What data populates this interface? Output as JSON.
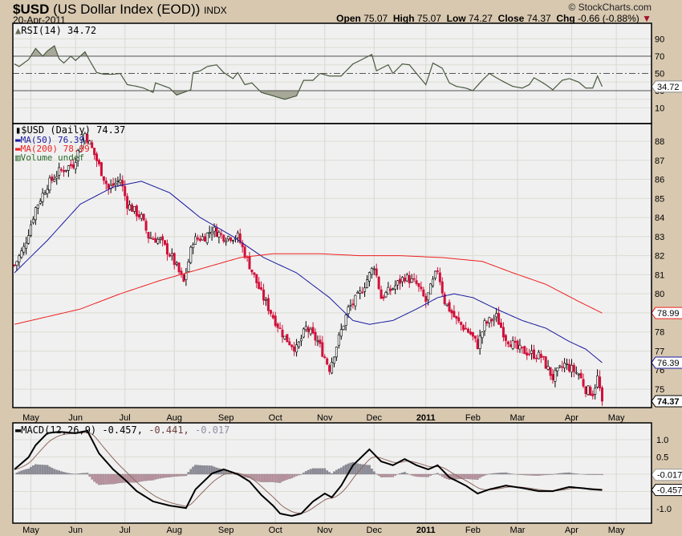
{
  "header": {
    "symbol": "$USD",
    "name": "(US Dollar Index (EOD))",
    "exchange": "INDX",
    "date": "20-Apr-2011",
    "brand": "© StockCharts.com",
    "open_label": "Open",
    "open": "75.07",
    "high_label": "High",
    "high": "75.07",
    "low_label": "Low",
    "low": "74.27",
    "close_label": "Close",
    "close": "74.37",
    "chg_label": "Chg",
    "chg": "-0.66 (-0.88%)"
  },
  "colors": {
    "background": "#d8c8b0",
    "plot": "#f0f0f0",
    "up": "#000000",
    "down": "#d0103a",
    "ma50": "#1a1aa0",
    "ma200": "#ee2020",
    "rsi": "#4a5a40",
    "rsi_fill": "#a8a898",
    "hist_pos": "#8a8a9a",
    "hist_neg": "#c090a0",
    "signal": "#906860"
  },
  "chart_data": [
    {
      "type": "line",
      "title": "RSI(14) 34.72",
      "legend": "RSI(14) 34.72",
      "last": "34.72",
      "ylim": [
        0,
        100
      ],
      "yticks": [
        "90",
        "70",
        "50",
        "30",
        "10"
      ],
      "overbought": 70,
      "oversold": 30,
      "x_units": "trading day index",
      "points": [
        [
          0,
          61
        ],
        [
          2,
          58
        ],
        [
          6,
          66
        ],
        [
          9,
          79
        ],
        [
          12,
          70
        ],
        [
          14,
          76
        ],
        [
          17,
          82
        ],
        [
          19,
          67
        ],
        [
          21,
          62
        ],
        [
          24,
          70
        ],
        [
          26,
          65
        ],
        [
          30,
          75
        ],
        [
          32,
          65
        ],
        [
          35,
          51
        ],
        [
          38,
          49
        ],
        [
          42,
          49
        ],
        [
          45,
          50
        ],
        [
          48,
          37
        ],
        [
          52,
          35
        ],
        [
          55,
          33
        ],
        [
          59,
          28
        ],
        [
          60,
          39
        ],
        [
          66,
          33
        ],
        [
          69,
          25
        ],
        [
          72,
          28
        ],
        [
          75,
          31
        ],
        [
          76,
          51
        ],
        [
          79,
          53
        ],
        [
          82,
          58
        ],
        [
          86,
          60
        ],
        [
          89,
          51
        ],
        [
          93,
          44
        ],
        [
          95,
          51
        ],
        [
          98,
          37
        ],
        [
          101,
          39
        ],
        [
          105,
          28
        ],
        [
          110,
          24
        ],
        [
          115,
          20
        ],
        [
          120,
          24
        ],
        [
          123,
          42
        ],
        [
          127,
          42
        ],
        [
          130,
          50
        ],
        [
          134,
          47
        ],
        [
          139,
          47
        ],
        [
          144,
          61
        ],
        [
          147,
          65
        ],
        [
          152,
          72
        ],
        [
          154,
          53
        ],
        [
          159,
          60
        ],
        [
          161,
          50
        ],
        [
          165,
          61
        ],
        [
          168,
          60
        ],
        [
          171,
          50
        ],
        [
          175,
          37
        ],
        [
          178,
          62
        ],
        [
          182,
          56
        ],
        [
          185,
          39
        ],
        [
          188,
          35
        ],
        [
          192,
          33
        ],
        [
          195,
          30
        ],
        [
          199,
          42
        ],
        [
          202,
          50
        ],
        [
          205,
          45
        ],
        [
          209,
          39
        ],
        [
          212,
          35
        ],
        [
          216,
          33
        ],
        [
          219,
          37
        ],
        [
          221,
          45
        ],
        [
          223,
          42
        ],
        [
          226,
          37
        ],
        [
          229,
          31
        ],
        [
          233,
          42
        ],
        [
          236,
          44
        ],
        [
          240,
          40
        ],
        [
          243,
          33
        ],
        [
          246,
          33
        ],
        [
          248,
          47
        ],
        [
          250,
          34.72
        ]
      ]
    },
    {
      "type": "candlestick",
      "title": "$USD (Daily) 74.37",
      "legend": [
        "$USD (Daily) 74.37",
        "MA(50) 76.39",
        "MA(200) 78.99",
        "Volume undef"
      ],
      "ylim": [
        74,
        88.9
      ],
      "yticks": [
        "88",
        "87",
        "86",
        "85",
        "84",
        "83",
        "82",
        "81",
        "80",
        "79",
        "78",
        "77",
        "76",
        "75"
      ],
      "x_ticks": [
        [
          "May",
          7
        ],
        [
          "Jun",
          26
        ],
        [
          "Jul",
          47
        ],
        [
          "Aug",
          68
        ],
        [
          "Sep",
          90
        ],
        [
          "Oct",
          111
        ],
        [
          "Nov",
          132
        ],
        [
          "Dec",
          153
        ],
        [
          "2011",
          175
        ],
        [
          "Feb",
          195
        ],
        [
          "Mar",
          214
        ],
        [
          "Apr",
          237
        ],
        [
          "May",
          256
        ]
      ],
      "close": [
        [
          0,
          81.5
        ],
        [
          4,
          82.4
        ],
        [
          9,
          84.5
        ],
        [
          14,
          85.7
        ],
        [
          19,
          86.4
        ],
        [
          25,
          86.8
        ],
        [
          30,
          88.4
        ],
        [
          33,
          87.6
        ],
        [
          37,
          86.4
        ],
        [
          40,
          85.5
        ],
        [
          45,
          86.0
        ],
        [
          48,
          84.7
        ],
        [
          54,
          84.0
        ],
        [
          57,
          83.0
        ],
        [
          62,
          82.8
        ],
        [
          67,
          81.9
        ],
        [
          72,
          80.6
        ],
        [
          76,
          82.8
        ],
        [
          81,
          83.0
        ],
        [
          84,
          83.4
        ],
        [
          89,
          83.0
        ],
        [
          95,
          83.0
        ],
        [
          100,
          81.5
        ],
        [
          105,
          80.0
        ],
        [
          110,
          78.8
        ],
        [
          115,
          77.7
        ],
        [
          120,
          77.1
        ],
        [
          124,
          78.2
        ],
        [
          129,
          77.5
        ],
        [
          134,
          76.1
        ],
        [
          137,
          77.3
        ],
        [
          142,
          79.2
        ],
        [
          147,
          80.0
        ],
        [
          153,
          81.5
        ],
        [
          156,
          79.8
        ],
        [
          161,
          80.3
        ],
        [
          166,
          80.9
        ],
        [
          171,
          80.5
        ],
        [
          175,
          79.6
        ],
        [
          180,
          81.3
        ],
        [
          183,
          79.6
        ],
        [
          188,
          78.6
        ],
        [
          194,
          77.9
        ],
        [
          197,
          77.3
        ],
        [
          200,
          78.4
        ],
        [
          205,
          78.8
        ],
        [
          209,
          77.7
        ],
        [
          214,
          77.1
        ],
        [
          219,
          76.9
        ],
        [
          224,
          76.7
        ],
        [
          229,
          75.6
        ],
        [
          234,
          76.3
        ],
        [
          240,
          75.8
        ],
        [
          243,
          75.0
        ],
        [
          246,
          74.8
        ],
        [
          248,
          75.6
        ],
        [
          250,
          74.37
        ]
      ],
      "ma50": {
        "label": "MA(50) 76.39",
        "last": "76.39",
        "points": [
          [
            0,
            81.1
          ],
          [
            14,
            82.8
          ],
          [
            28,
            84.7
          ],
          [
            42,
            85.6
          ],
          [
            54,
            85.9
          ],
          [
            66,
            85.3
          ],
          [
            79,
            84.0
          ],
          [
            93,
            83.0
          ],
          [
            106,
            81.9
          ],
          [
            120,
            81.1
          ],
          [
            134,
            79.8
          ],
          [
            144,
            78.6
          ],
          [
            151,
            78.4
          ],
          [
            161,
            78.6
          ],
          [
            171,
            79.2
          ],
          [
            180,
            79.8
          ],
          [
            187,
            80.0
          ],
          [
            195,
            79.8
          ],
          [
            205,
            79.2
          ],
          [
            216,
            78.6
          ],
          [
            226,
            78.2
          ],
          [
            236,
            77.5
          ],
          [
            243,
            77.1
          ],
          [
            250,
            76.39
          ]
        ]
      },
      "ma200": {
        "label": "MA(200) 78.99",
        "last": "78.99",
        "points": [
          [
            0,
            78.4
          ],
          [
            14,
            78.8
          ],
          [
            28,
            79.2
          ],
          [
            45,
            80.0
          ],
          [
            62,
            80.7
          ],
          [
            79,
            81.3
          ],
          [
            96,
            81.9
          ],
          [
            110,
            82.1
          ],
          [
            130,
            82.1
          ],
          [
            147,
            82.0
          ],
          [
            164,
            82.0
          ],
          [
            182,
            81.9
          ],
          [
            199,
            81.7
          ],
          [
            212,
            81.1
          ],
          [
            226,
            80.5
          ],
          [
            240,
            79.6
          ],
          [
            250,
            78.99
          ]
        ]
      },
      "volume_label": "Volume undef",
      "last": "74.37"
    },
    {
      "type": "line",
      "title": "MACD(12,26,9)",
      "legend": {
        "name": "MACD(12,26,9)",
        "macd": "-0.457,",
        "signal": "-0.441,",
        "hist": "-0.017"
      },
      "ylim": [
        -1.42,
        1.4
      ],
      "yticks": [
        "1.0",
        "0.5",
        "-1.0"
      ],
      "last_macd": "-0.457",
      "last_hist": "-0.017",
      "macd": [
        [
          0,
          0.14
        ],
        [
          6,
          0.49
        ],
        [
          9,
          0.84
        ],
        [
          14,
          1.19
        ],
        [
          19,
          1.23
        ],
        [
          26,
          1.19
        ],
        [
          31,
          1.26
        ],
        [
          36,
          0.6
        ],
        [
          42,
          0.14
        ],
        [
          47,
          -0.16
        ],
        [
          52,
          -0.49
        ],
        [
          59,
          -0.79
        ],
        [
          66,
          -0.91
        ],
        [
          73,
          -0.98
        ],
        [
          77,
          -0.44
        ],
        [
          84,
          0.02
        ],
        [
          89,
          0.14
        ],
        [
          95,
          0
        ],
        [
          100,
          -0.21
        ],
        [
          105,
          -0.6
        ],
        [
          110,
          -0.91
        ],
        [
          113,
          -1.14
        ],
        [
          118,
          -1.21
        ],
        [
          122,
          -1.14
        ],
        [
          127,
          -0.79
        ],
        [
          132,
          -0.56
        ],
        [
          135,
          -0.67
        ],
        [
          139,
          -0.33
        ],
        [
          144,
          0.26
        ],
        [
          151,
          0.72
        ],
        [
          156,
          0.37
        ],
        [
          161,
          0.26
        ],
        [
          166,
          0.44
        ],
        [
          171,
          0.26
        ],
        [
          176,
          0.14
        ],
        [
          180,
          0.26
        ],
        [
          185,
          -0.09
        ],
        [
          192,
          -0.33
        ],
        [
          197,
          -0.56
        ],
        [
          202,
          -0.44
        ],
        [
          209,
          -0.33
        ],
        [
          216,
          -0.4
        ],
        [
          223,
          -0.49
        ],
        [
          229,
          -0.49
        ],
        [
          236,
          -0.37
        ],
        [
          241,
          -0.4
        ],
        [
          246,
          -0.44
        ],
        [
          250,
          -0.457
        ]
      ]
    }
  ]
}
